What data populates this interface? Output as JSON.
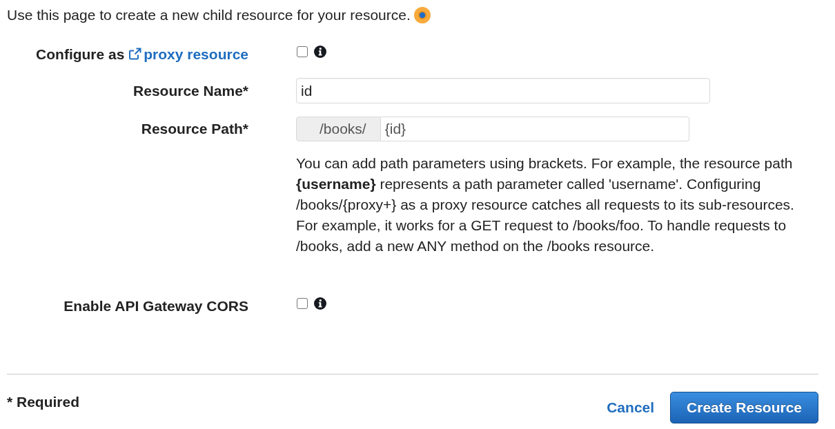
{
  "intro": {
    "text": "Use this page to create a new child resource for your resource."
  },
  "fields": [
    {
      "kind": "checkbox",
      "label": "Configure as",
      "link": "proxy resource",
      "checked": false
    },
    {
      "kind": "text",
      "label": "Resource Name*",
      "value": "id"
    },
    {
      "kind": "path",
      "label": "Resource Path*",
      "prefix": "/books/",
      "value": "{id}",
      "help": "You can add path parameters using brackets. For example, the resource path **{username}** represents a path parameter called 'username'. Configuring /books/{proxy+} as a proxy resource catches all requests to its sub-resources. For example, it works for a GET request to /books/foo. To handle requests to /books, add a new ANY method on the /books resource."
    },
    {
      "kind": "checkbox",
      "label": "Enable API Gateway CORS",
      "checked": false
    }
  ],
  "footer": {
    "note": "* Required",
    "buttons": [
      {
        "kind": "link",
        "label": "Cancel"
      },
      {
        "kind": "primary",
        "label": "Create Resource"
      }
    ]
  }
}
